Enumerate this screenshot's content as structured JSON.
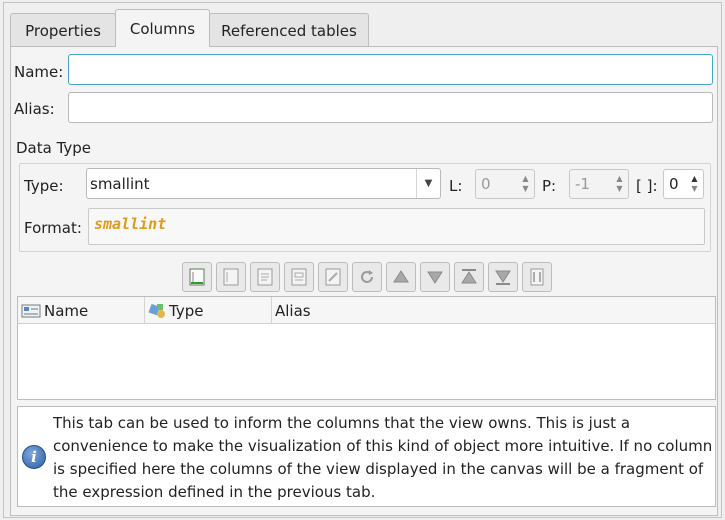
{
  "tabs": [
    {
      "label": "Properties"
    },
    {
      "label": "Columns"
    },
    {
      "label": "Referenced tables"
    }
  ],
  "form": {
    "name_label": "Name:",
    "name_value": "",
    "alias_label": "Alias:",
    "alias_value": ""
  },
  "data_type": {
    "group_title": "Data Type",
    "type_label": "Type:",
    "type_value": "smallint",
    "length_label": "L:",
    "length_value": "0",
    "precision_label": "P:",
    "precision_value": "-1",
    "dimension_label": "[ ]:",
    "dimension_value": "0",
    "format_label": "Format:",
    "format_value": "smallint",
    "format_color": "#e09a1a"
  },
  "toolbar": {
    "buttons": [
      {
        "icon": "add-item-icon"
      },
      {
        "icon": "update-item-icon"
      },
      {
        "icon": "edit-item-icon"
      },
      {
        "icon": "duplicate-item-icon"
      },
      {
        "icon": "edit-content-icon"
      },
      {
        "icon": "refresh-icon"
      },
      {
        "icon": "move-up-icon"
      },
      {
        "icon": "move-down-icon"
      },
      {
        "icon": "move-to-top-icon"
      },
      {
        "icon": "move-to-bottom-icon"
      },
      {
        "icon": "remove-item-icon"
      }
    ]
  },
  "table": {
    "columns": [
      {
        "label": "Name",
        "icon": "column-icon"
      },
      {
        "label": "Type",
        "icon": "type-icon"
      },
      {
        "label": "Alias",
        "icon": ""
      }
    ],
    "rows": []
  },
  "info": {
    "icon": "info-icon",
    "text": "This tab can be used to inform the columns that the view owns. This is just a convenience to make the visualization of this kind of object more intuitive. If no column is specified here the columns of the view displayed in the canvas will be a fragment of the expression defined in the previous tab."
  }
}
